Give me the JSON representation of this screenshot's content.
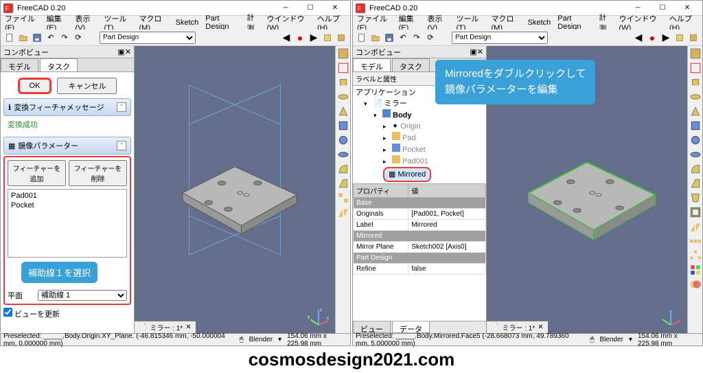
{
  "app": {
    "title": "FreeCAD 0.20"
  },
  "menu": {
    "file": "ファイル(F)",
    "edit": "編集(E)",
    "view": "表示(V)",
    "tools": "ツール(T)",
    "macro": "マクロ(M)",
    "sketch": "Sketch",
    "partdesign": "Part Design",
    "measure": "計測",
    "window": "ウインドウ(W)",
    "help": "ヘルプ(H)"
  },
  "workbench": "Part Design",
  "combo": {
    "title": "コンボビュー",
    "tabs": {
      "model": "モデル",
      "task": "タスク"
    },
    "ok": "OK",
    "cancel": "キャンセル",
    "transform_msg_head": "変換フィーチャメッセージ",
    "transform_msg": "変換成功",
    "param_head": "鏡像パラメーター",
    "add_feature": "フィーチャーを追加",
    "remove_feature": "フィーチャーを削除",
    "features": [
      "Pad001",
      "Pocket"
    ],
    "annotation1": "補助線１を選択",
    "plane_label": "平面",
    "plane_value": "補助線 1",
    "update_view": "ビューを更新"
  },
  "viewport": {
    "doc_tab": "ミラー : 1*"
  },
  "tree": {
    "labels_attrs": "ラベルと属性",
    "application": "アプリケーション",
    "doc": "ミラー",
    "body": "Body",
    "origin": "Origin",
    "pad": "Pad",
    "pocket": "Pocket",
    "pad001": "Pad001",
    "mirrored": "Mirrored"
  },
  "annotation2_line1": "Mirroredをダブルクリックして",
  "annotation2_line2": "鏡像パラメーターを編集",
  "props": {
    "header_prop": "プロパティ",
    "header_val": "値",
    "group_base": "Base",
    "originals_k": "Originals",
    "originals_v": "[Pad001, Pocket]",
    "label_k": "Label",
    "label_v": "Mirrored",
    "group_mirrored": "Mirrored",
    "mirrorplane_k": "Mirror Plane",
    "mirrorplane_v": "Sketch002 [Axis0]",
    "group_partdesign": "Part Design",
    "refine_k": "Refine",
    "refine_v": "false"
  },
  "bottom_tabs": {
    "view": "ビュー",
    "data": "データ"
  },
  "status": {
    "left": {
      "preselected": "Preselected: _____.Body.Origin.XY_Plane. (-46.815346 mm, -50.000004 mm, 0.000000 mm)",
      "nav": "Blender",
      "dims": "154.06 mm x 225.98 mm"
    },
    "right": {
      "preselected": "Preselected: _____.Body.Mirrored.Face5 (-28.668073 mm, 49.789360 mm, 5.000000 mm)",
      "nav": "Blender",
      "dims": "154.06 mm x 225.98 mm"
    }
  },
  "footer": "cosmosdesign2021.com"
}
